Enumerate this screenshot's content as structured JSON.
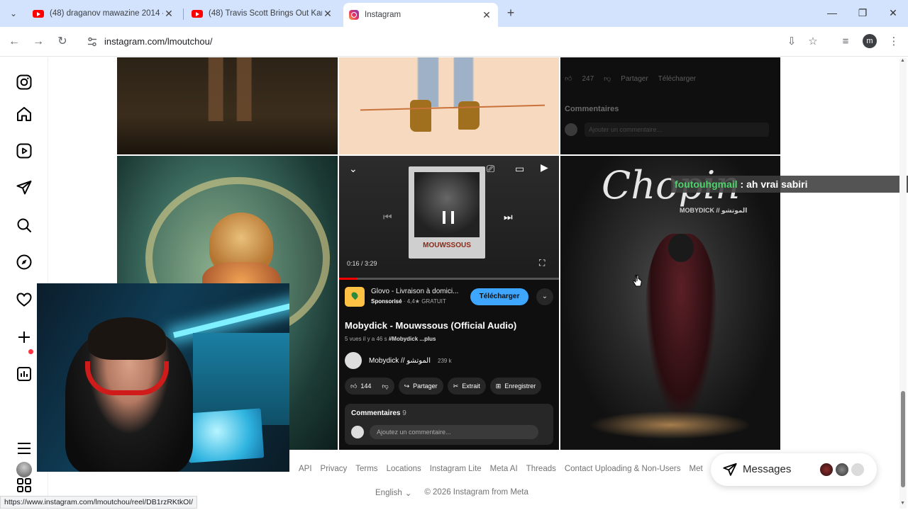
{
  "browser": {
    "tabs": [
      {
        "title": "(48) draganov mawazine 2014 -",
        "favicon": "youtube-icon",
        "close": "✕"
      },
      {
        "title": "(48) Travis Scott Brings Out Kan",
        "favicon": "youtube-icon",
        "close": "✕"
      },
      {
        "title": "Instagram",
        "favicon": "instagram-icon",
        "close": "✕",
        "active": true
      }
    ],
    "new_tab": "+",
    "window_buttons": {
      "minimize": "—",
      "restore": "❐",
      "close": "✕"
    },
    "url": "instagram.com/lmoutchou/",
    "profile_initial": "m",
    "status_url": "https://www.instagram.com/lmoutchou/reel/DB1rzRKtkOI/"
  },
  "ig_sidebar": {
    "items": [
      "instagram-logo-icon",
      "home-icon",
      "reels-icon",
      "messages-icon",
      "search-icon",
      "explore-icon",
      "notifications-icon",
      "create-icon",
      "dashboard-icon",
      "profile-avatar",
      "more-menu-icon",
      "meta-apps-icon"
    ]
  },
  "grid": {
    "top_right": {
      "likes": "247",
      "share": "Partager",
      "download": "Télécharger",
      "comments_header": "Commentaires",
      "comment_placeholder": "Ajouter un commentaire…"
    },
    "video_post": {
      "time": "0:16 / 3:29",
      "progress_fraction": 0.08,
      "polaroid_caption": "MOUWSSOUS",
      "ad_title": "Glovo - Livraison à domici...",
      "ad_sponsored": "Sponsorisé",
      "ad_meta": " · 4,4★  GRATUIT",
      "ad_button": "Télécharger",
      "video_title": "Mobydick - Mouwssous (Official Audio)",
      "views_meta": "5 vues   il y a 46 s",
      "hashtag": "#Mobydick ...plus",
      "channel": "Mobydick // الموتشو",
      "subscribers": "239 k",
      "likes": "144",
      "share": "Partager",
      "clip": "Extrait",
      "save": "Enregistrer",
      "comments_label": "Commentaires",
      "comments_count": "9",
      "comment_placeholder": "Ajoutez un commentaire..."
    },
    "chopin_post": {
      "logo_text": "Chopin",
      "artist": "MOBYDICK // الموتشو"
    }
  },
  "chat_overlay": {
    "user": "foutouhgmail",
    "message": " : ah vrai sabiri"
  },
  "footer": {
    "links": [
      "API",
      "Privacy",
      "Terms",
      "Locations",
      "Instagram Lite",
      "Meta AI",
      "Threads",
      "Contact Uploading & Non-Users",
      "Met"
    ],
    "language": "English",
    "copyright": "© 2026 Instagram from Meta"
  },
  "messages_pill": {
    "label": "Messages"
  }
}
